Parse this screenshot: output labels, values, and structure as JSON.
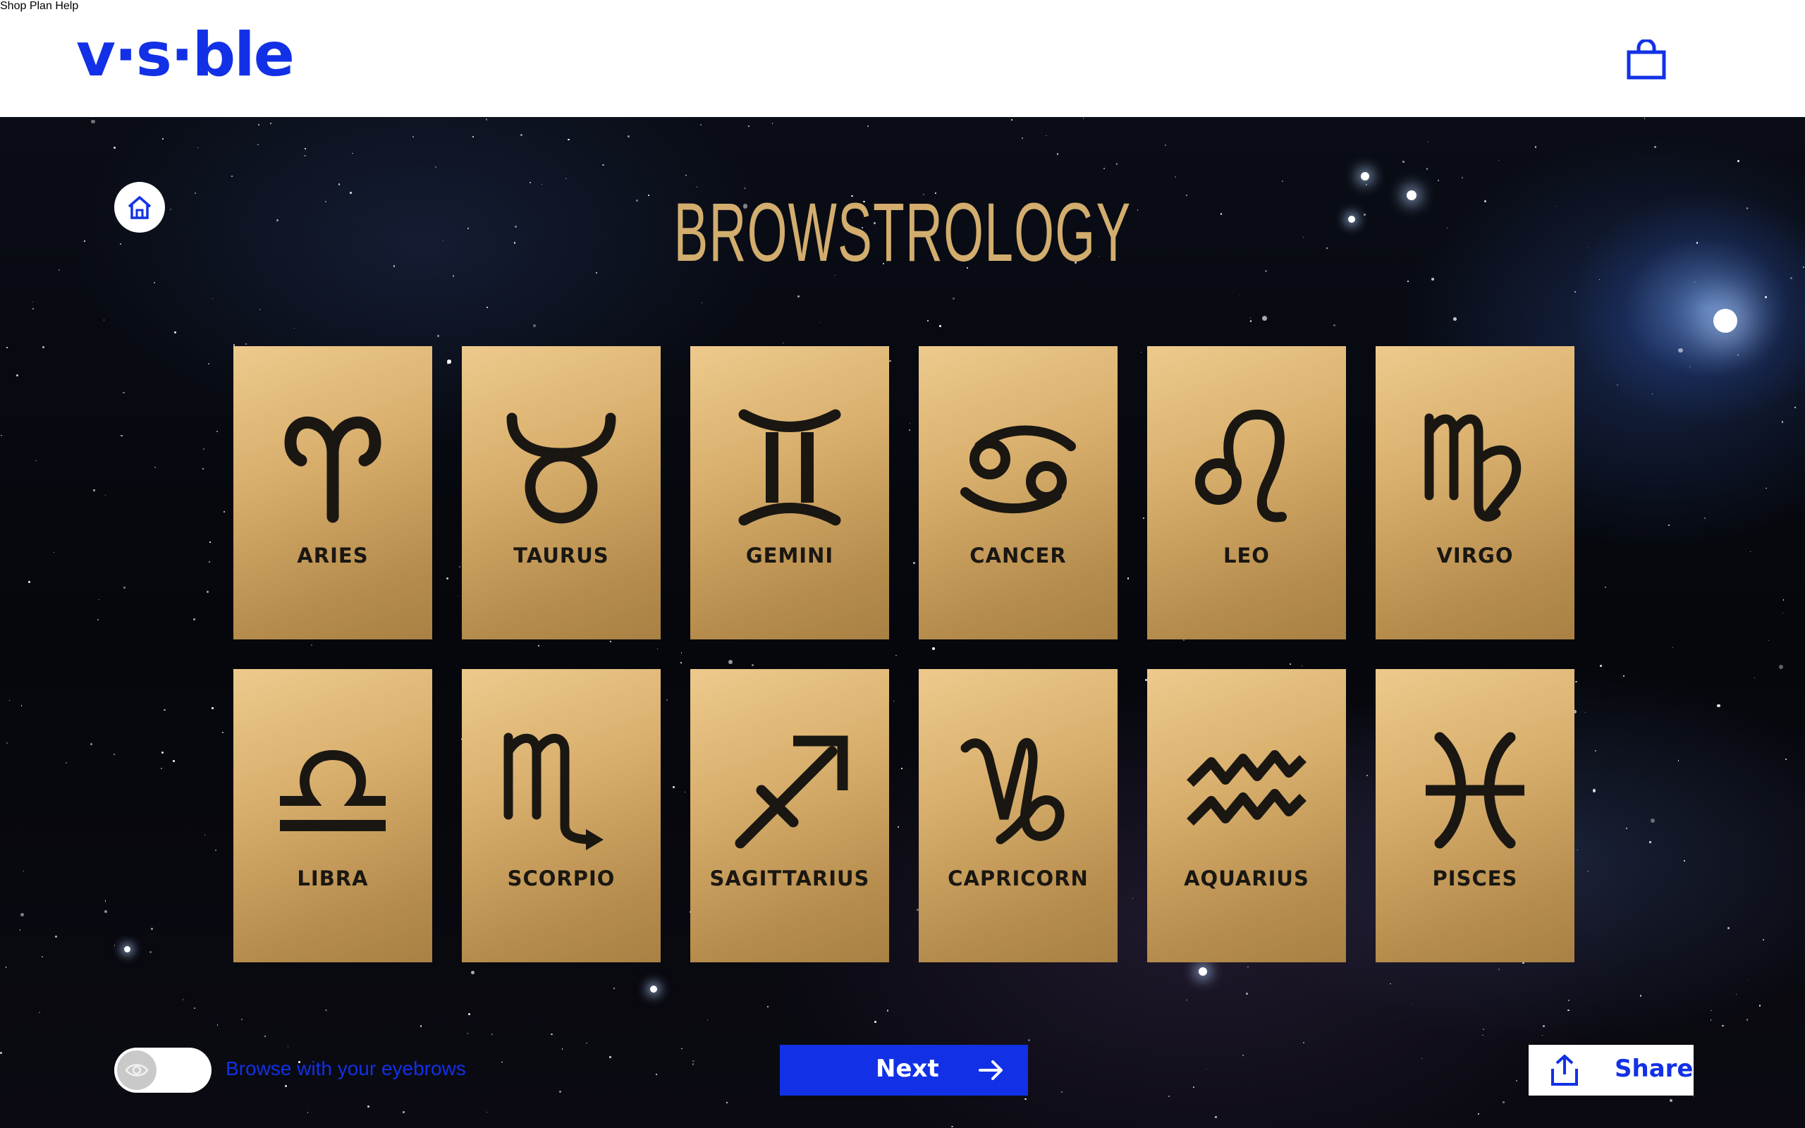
{
  "header": {
    "logo": "v·s·ble",
    "nav": [
      {
        "label": "Shop"
      },
      {
        "label": "Plan"
      },
      {
        "label": "Help"
      }
    ],
    "cart_icon": "shopping-bag-icon"
  },
  "colors": {
    "brand": "#1231e6",
    "title_gold": "#d2ad6d",
    "card_gold": "#d8ae6c"
  },
  "title": "BROWSTROLOGY",
  "signs": [
    {
      "label": "ARIES",
      "icon": "aries-icon"
    },
    {
      "label": "TAURUS",
      "icon": "taurus-icon"
    },
    {
      "label": "GEMINI",
      "icon": "gemini-icon"
    },
    {
      "label": "CANCER",
      "icon": "cancer-icon"
    },
    {
      "label": "LEO",
      "icon": "leo-icon"
    },
    {
      "label": "VIRGO",
      "icon": "virgo-icon"
    },
    {
      "label": "LIBRA",
      "icon": "libra-icon"
    },
    {
      "label": "SCORPIO",
      "icon": "scorpio-icon"
    },
    {
      "label": "SAGITTARIUS",
      "icon": "sagittarius-icon"
    },
    {
      "label": "CAPRICORN",
      "icon": "capricorn-icon"
    },
    {
      "label": "AQUARIUS",
      "icon": "aquarius-icon"
    },
    {
      "label": "PISCES",
      "icon": "pisces-icon"
    }
  ],
  "controls": {
    "toggle_label": "Browse with your eyebrows",
    "toggle_on": false,
    "next_label": "Next",
    "share_label": "Share"
  }
}
